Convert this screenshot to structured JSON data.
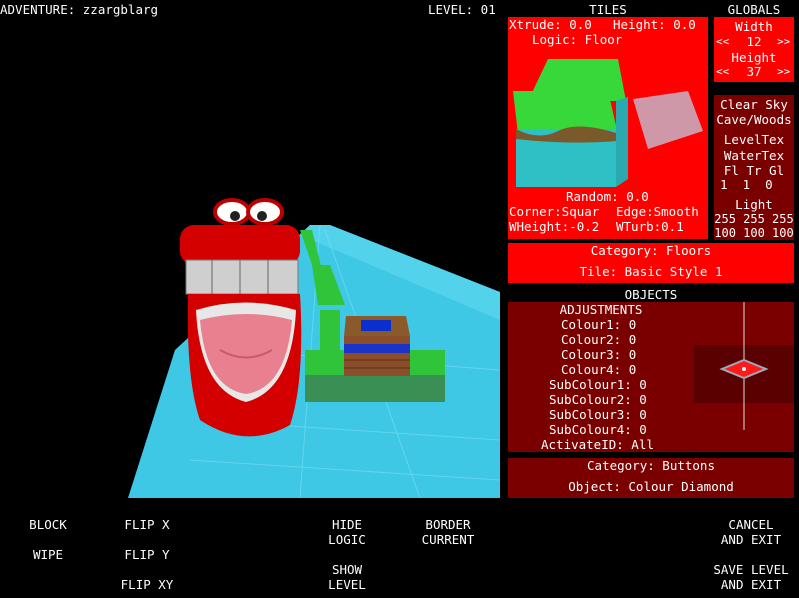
{
  "header": {
    "adventure": "ADVENTURE: zzargblarg",
    "level": "LEVEL: 01"
  },
  "tiles": {
    "title": "TILES",
    "xtrude": "Xtrude: 0.0",
    "height": "Height: 0.0",
    "logic": "Logic: Floor",
    "random": "Random: 0.0",
    "corner": "Corner:Squar",
    "edge": "Edge:Smooth",
    "wheight": "WHeight:-0.2",
    "wturb": "WTurb:0.1",
    "category": "Category: Floors",
    "tile": "Tile: Basic Style 1"
  },
  "globals": {
    "title": "GLOBALS",
    "width_label": "Width",
    "width_value": "12",
    "height_label": "Height",
    "height_value": "37",
    "prev": "<<",
    "next": ">>",
    "sky": "Clear Sky",
    "cave": "Cave/Woods",
    "leveltex": "LevelTex",
    "watertex": "WaterTex",
    "fl_tr_gl": "Fl Tr Gl",
    "fl_tr_gl_values": "1  1  0",
    "light": "Light",
    "light_row1": "255 255 255",
    "light_row2": "100 100 100"
  },
  "objects": {
    "title": "OBJECTS",
    "adjustments": "ADJUSTMENTS",
    "rows": [
      "Colour1: 0",
      "Colour2: 0",
      "Colour3: 0",
      "Colour4: 0",
      "SubColour1: 0",
      "SubColour2: 0",
      "SubColour3: 0",
      "SubColour4: 0",
      "ActivateID: All"
    ],
    "category": "Category: Buttons",
    "object": "Object: Colour Diamond"
  },
  "toolbar": {
    "block": "BLOCK",
    "wipe": "WIPE",
    "flip_x": "FLIP X",
    "flip_y": "FLIP Y",
    "flip_xy": "FLIP XY",
    "hide_logic": "HIDE\nLOGIC",
    "show_level": "SHOW\nLEVEL",
    "border_current": "BORDER\nCURRENT",
    "cancel_exit": "CANCEL\nAND EXIT",
    "save_exit": "SAVE LEVEL\nAND EXIT"
  },
  "colors": {
    "panel_red": "#ff0000",
    "panel_dark": "#7a0000",
    "water": "#3fc7e6",
    "grass": "#2fc43a"
  }
}
